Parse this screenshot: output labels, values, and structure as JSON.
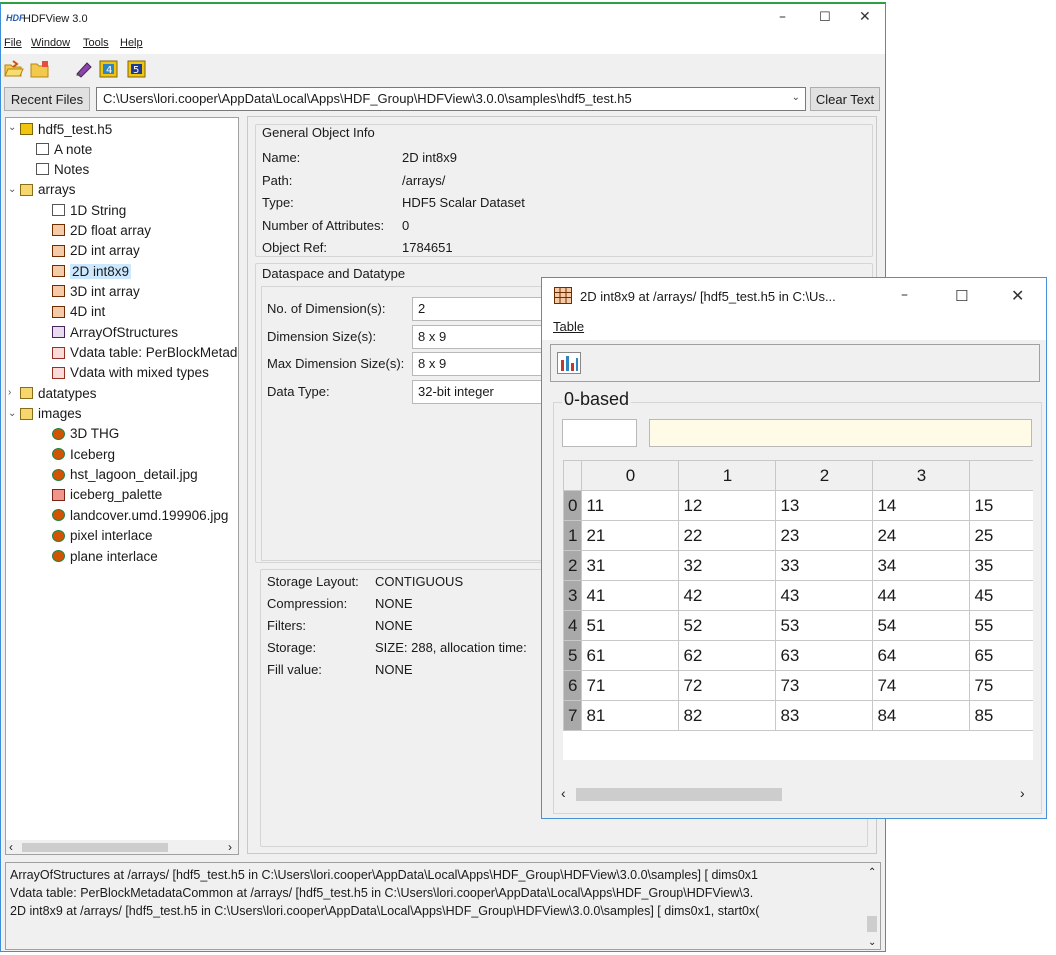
{
  "app": {
    "title": "HDFView 3.0",
    "menu": [
      "File",
      "Window",
      "Tools",
      "Help"
    ],
    "recent_files_label": "Recent Files",
    "path_value": "C:\\Users\\lori.cooper\\AppData\\Local\\Apps\\HDF_Group\\HDFView\\3.0.0\\samples\\hdf5_test.h5",
    "clear_text_label": "Clear Text"
  },
  "tree": {
    "root": "hdf5_test.h5",
    "items": [
      {
        "label": "A note",
        "icon": "note-icon"
      },
      {
        "label": "Notes",
        "icon": "note-icon"
      },
      {
        "label": "arrays",
        "icon": "folder-open-icon"
      },
      {
        "label": "1D String",
        "icon": "dataset-text-icon"
      },
      {
        "label": "2D float array",
        "icon": "dataset-icon"
      },
      {
        "label": "2D int array",
        "icon": "dataset-icon"
      },
      {
        "label": "2D int8x9",
        "icon": "dataset-icon"
      },
      {
        "label": "3D int array",
        "icon": "dataset-icon"
      },
      {
        "label": "4D int",
        "icon": "dataset-icon"
      },
      {
        "label": "ArrayOfStructures",
        "icon": "compound-icon"
      },
      {
        "label": "Vdata table: PerBlockMetadataCommon",
        "icon": "vdata-icon"
      },
      {
        "label": "Vdata with mixed types",
        "icon": "vdata-icon"
      },
      {
        "label": "datatypes",
        "icon": "folder-closed-icon"
      },
      {
        "label": "images",
        "icon": "folder-open-icon"
      },
      {
        "label": "3D THG",
        "icon": "image-icon"
      },
      {
        "label": "Iceberg",
        "icon": "image-icon"
      },
      {
        "label": "hst_lagoon_detail.jpg",
        "icon": "image-icon"
      },
      {
        "label": "iceberg_palette",
        "icon": "palette-icon"
      },
      {
        "label": "landcover.umd.199906.jpg",
        "icon": "image-icon"
      },
      {
        "label": "pixel interlace",
        "icon": "image-icon"
      },
      {
        "label": "plane interlace",
        "icon": "image-icon"
      }
    ]
  },
  "general": {
    "title": "General Object Info",
    "rows": [
      {
        "k": "Name:",
        "v": "2D int8x9"
      },
      {
        "k": "Path:",
        "v": "/arrays/"
      },
      {
        "k": "Type:",
        "v": "HDF5 Scalar Dataset"
      },
      {
        "k": "Number of Attributes:",
        "v": "0"
      },
      {
        "k": "Object Ref:",
        "v": "1784651"
      }
    ]
  },
  "dataspace": {
    "title": "Dataspace and Datatype",
    "rows": [
      {
        "k": "No. of Dimension(s):",
        "v": "2"
      },
      {
        "k": "Dimension Size(s):",
        "v": "8 x 9"
      },
      {
        "k": "Max Dimension Size(s):",
        "v": "8 x 9"
      },
      {
        "k": "Data Type:",
        "v": "32-bit integer"
      }
    ]
  },
  "storage": {
    "rows": [
      {
        "k": "Storage Layout:",
        "v": "CONTIGUOUS"
      },
      {
        "k": "Compression:",
        "v": "NONE"
      },
      {
        "k": "Filters:",
        "v": "NONE"
      },
      {
        "k": "Storage:",
        "v": "SIZE: 288, allocation time:"
      },
      {
        "k": "Fill value:",
        "v": "NONE"
      }
    ]
  },
  "log": [
    "ArrayOfStructures  at  /arrays/  [hdf5_test.h5  in  C:\\Users\\lori.cooper\\AppData\\Local\\Apps\\HDF_Group\\HDFView\\3.0.0\\samples] [ dims0x1",
    "Vdata table: PerBlockMetadataCommon  at  /arrays/  [hdf5_test.h5  in  C:\\Users\\lori.cooper\\AppData\\Local\\Apps\\HDF_Group\\HDFView\\3.",
    "2D int8x9  at  /arrays/  [hdf5_test.h5  in  C:\\Users\\lori.cooper\\AppData\\Local\\Apps\\HDF_Group\\HDFView\\3.0.0\\samples] [ dims0x1, start0x("
  ],
  "table_window": {
    "title": "2D int8x9  at  /arrays/  [hdf5_test.h5  in  C:\\Us...",
    "menu": "Table",
    "index_label": "0-based",
    "columns": [
      "0",
      "1",
      "2",
      "3",
      ""
    ],
    "rows": [
      {
        "idx": "0",
        "cells": [
          "11",
          "12",
          "13",
          "14",
          "15"
        ]
      },
      {
        "idx": "1",
        "cells": [
          "21",
          "22",
          "23",
          "24",
          "25"
        ]
      },
      {
        "idx": "2",
        "cells": [
          "31",
          "32",
          "33",
          "34",
          "35"
        ]
      },
      {
        "idx": "3",
        "cells": [
          "41",
          "42",
          "43",
          "44",
          "45"
        ]
      },
      {
        "idx": "4",
        "cells": [
          "51",
          "52",
          "53",
          "54",
          "55"
        ]
      },
      {
        "idx": "5",
        "cells": [
          "61",
          "62",
          "63",
          "64",
          "65"
        ]
      },
      {
        "idx": "6",
        "cells": [
          "71",
          "72",
          "73",
          "74",
          "75"
        ]
      },
      {
        "idx": "7",
        "cells": [
          "81",
          "82",
          "83",
          "84",
          "85"
        ]
      }
    ]
  },
  "colors": {
    "selection": "#cce8ff",
    "accent": "#3f8fd8",
    "row_header": "#a9a9a9"
  }
}
